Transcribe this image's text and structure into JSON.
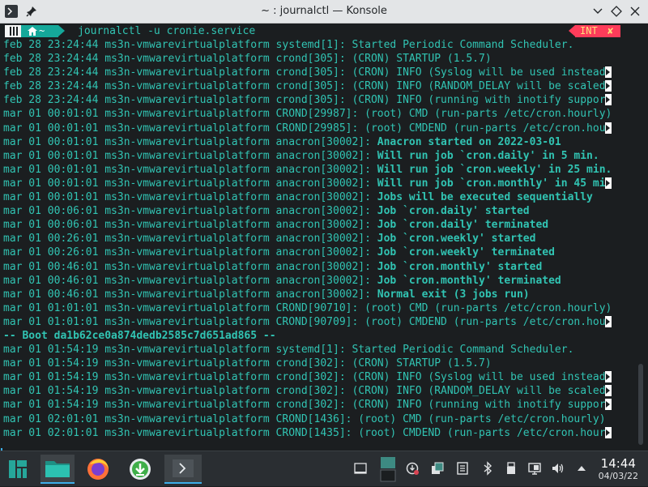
{
  "window": {
    "title": "~ : journalctl — Konsole",
    "app_icon": "konsole-icon",
    "pin_icon": "pin-icon",
    "controls": [
      "chevron-down-icon",
      "diamond-icon",
      "close-icon"
    ]
  },
  "prompt": {
    "os_icon": "manjaro-icon",
    "dir_icon": "home-icon",
    "dir": "~",
    "command": "journalctl -u cronie.service",
    "status": "INT",
    "status_icon": "✘"
  },
  "log": [
    {
      "prefix": "feb 28 23:24:44 ms3n-vmwarevirtualplatform systemd[1]: ",
      "msg": "Started Periodic Command Scheduler.",
      "bold": false,
      "trunc": false
    },
    {
      "prefix": "feb 28 23:24:44 ms3n-vmwarevirtualplatform crond[305]: ",
      "msg": "(CRON) STARTUP (1.5.7)",
      "bold": false,
      "trunc": false
    },
    {
      "prefix": "feb 28 23:24:44 ms3n-vmwarevirtualplatform crond[305]: ",
      "msg": "(CRON) INFO (Syslog will be used instead",
      "bold": false,
      "trunc": true
    },
    {
      "prefix": "feb 28 23:24:44 ms3n-vmwarevirtualplatform crond[305]: ",
      "msg": "(CRON) INFO (RANDOM_DELAY will be scaled",
      "bold": false,
      "trunc": true
    },
    {
      "prefix": "feb 28 23:24:44 ms3n-vmwarevirtualplatform crond[305]: ",
      "msg": "(CRON) INFO (running with inotify suppor",
      "bold": false,
      "trunc": true
    },
    {
      "prefix": "mar 01 00:01:01 ms3n-vmwarevirtualplatform CROND[29987]: ",
      "msg": "(root) CMD (run-parts /etc/cron.hourly)",
      "bold": false,
      "trunc": false
    },
    {
      "prefix": "mar 01 00:01:01 ms3n-vmwarevirtualplatform CROND[29985]: ",
      "msg": "(root) CMDEND (run-parts /etc/cron.hou",
      "bold": false,
      "trunc": true
    },
    {
      "prefix": "mar 01 00:01:01 ms3n-vmwarevirtualplatform anacron[30002]: ",
      "msg": "Anacron started on 2022-03-01",
      "bold": true,
      "trunc": false
    },
    {
      "prefix": "mar 01 00:01:01 ms3n-vmwarevirtualplatform anacron[30002]: ",
      "msg": "Will run job `cron.daily' in 5 min.",
      "bold": true,
      "trunc": false
    },
    {
      "prefix": "mar 01 00:01:01 ms3n-vmwarevirtualplatform anacron[30002]: ",
      "msg": "Will run job `cron.weekly' in 25 min.",
      "bold": true,
      "trunc": false
    },
    {
      "prefix": "mar 01 00:01:01 ms3n-vmwarevirtualplatform anacron[30002]: ",
      "msg": "Will run job `cron.monthly' in 45 mi",
      "bold": true,
      "trunc": true
    },
    {
      "prefix": "mar 01 00:01:01 ms3n-vmwarevirtualplatform anacron[30002]: ",
      "msg": "Jobs will be executed sequentially",
      "bold": true,
      "trunc": false
    },
    {
      "prefix": "mar 01 00:06:01 ms3n-vmwarevirtualplatform anacron[30002]: ",
      "msg": "Job `cron.daily' started",
      "bold": true,
      "trunc": false
    },
    {
      "prefix": "mar 01 00:06:01 ms3n-vmwarevirtualplatform anacron[30002]: ",
      "msg": "Job `cron.daily' terminated",
      "bold": true,
      "trunc": false
    },
    {
      "prefix": "mar 01 00:26:01 ms3n-vmwarevirtualplatform anacron[30002]: ",
      "msg": "Job `cron.weekly' started",
      "bold": true,
      "trunc": false
    },
    {
      "prefix": "mar 01 00:26:01 ms3n-vmwarevirtualplatform anacron[30002]: ",
      "msg": "Job `cron.weekly' terminated",
      "bold": true,
      "trunc": false
    },
    {
      "prefix": "mar 01 00:46:01 ms3n-vmwarevirtualplatform anacron[30002]: ",
      "msg": "Job `cron.monthly' started",
      "bold": true,
      "trunc": false
    },
    {
      "prefix": "mar 01 00:46:01 ms3n-vmwarevirtualplatform anacron[30002]: ",
      "msg": "Job `cron.monthly' terminated",
      "bold": true,
      "trunc": false
    },
    {
      "prefix": "mar 01 00:46:01 ms3n-vmwarevirtualplatform anacron[30002]: ",
      "msg": "Normal exit (3 jobs run)",
      "bold": true,
      "trunc": false
    },
    {
      "prefix": "mar 01 01:01:01 ms3n-vmwarevirtualplatform CROND[90710]: ",
      "msg": "(root) CMD (run-parts /etc/cron.hourly)",
      "bold": false,
      "trunc": false
    },
    {
      "prefix": "mar 01 01:01:01 ms3n-vmwarevirtualplatform CROND[90709]: ",
      "msg": "(root) CMDEND (run-parts /etc/cron.hou",
      "bold": false,
      "trunc": true
    },
    {
      "prefix": "",
      "msg": "-- Boot da1b62ce0a874dedb2585c7d651ad865 --",
      "bold": true,
      "trunc": false
    },
    {
      "prefix": "mar 01 01:54:19 ms3n-vmwarevirtualplatform systemd[1]: ",
      "msg": "Started Periodic Command Scheduler.",
      "bold": false,
      "trunc": false
    },
    {
      "prefix": "mar 01 01:54:19 ms3n-vmwarevirtualplatform crond[302]: ",
      "msg": "(CRON) STARTUP (1.5.7)",
      "bold": false,
      "trunc": false
    },
    {
      "prefix": "mar 01 01:54:19 ms3n-vmwarevirtualplatform crond[302]: ",
      "msg": "(CRON) INFO (Syslog will be used instead",
      "bold": false,
      "trunc": true
    },
    {
      "prefix": "mar 01 01:54:19 ms3n-vmwarevirtualplatform crond[302]: ",
      "msg": "(CRON) INFO (RANDOM_DELAY will be scaled",
      "bold": false,
      "trunc": true
    },
    {
      "prefix": "mar 01 01:54:19 ms3n-vmwarevirtualplatform crond[302]: ",
      "msg": "(CRON) INFO (running with inotify suppor",
      "bold": false,
      "trunc": true
    },
    {
      "prefix": "mar 01 02:01:01 ms3n-vmwarevirtualplatform CROND[1436]: ",
      "msg": "(root) CMD (run-parts /etc/cron.hourly)",
      "bold": false,
      "trunc": false
    },
    {
      "prefix": "mar 01 02:01:01 ms3n-vmwarevirtualplatform CROND[1435]: ",
      "msg": "(root) CMDEND (run-parts /etc/cron.hour",
      "bold": false,
      "trunc": true
    }
  ],
  "taskbar": {
    "launcher": "manjaro-menu-icon",
    "tasks": [
      "file-manager-icon",
      "firefox-icon",
      "download-manager-icon",
      "konsole-icon"
    ],
    "tray": [
      "window-icon",
      "desktop-pager-icon",
      "update-icon",
      "clipboard-icon",
      "notes-icon",
      "bluetooth-icon",
      "usb-icon",
      "display-icon",
      "volume-icon",
      "expand-tray-icon"
    ],
    "time": "14:44",
    "date": "04/03/22"
  },
  "colors": {
    "terminal_bg": "#1b1e20",
    "terminal_fg": "#31c4b3",
    "accent": "#3daee9",
    "int_status": "#ff3c5a"
  }
}
